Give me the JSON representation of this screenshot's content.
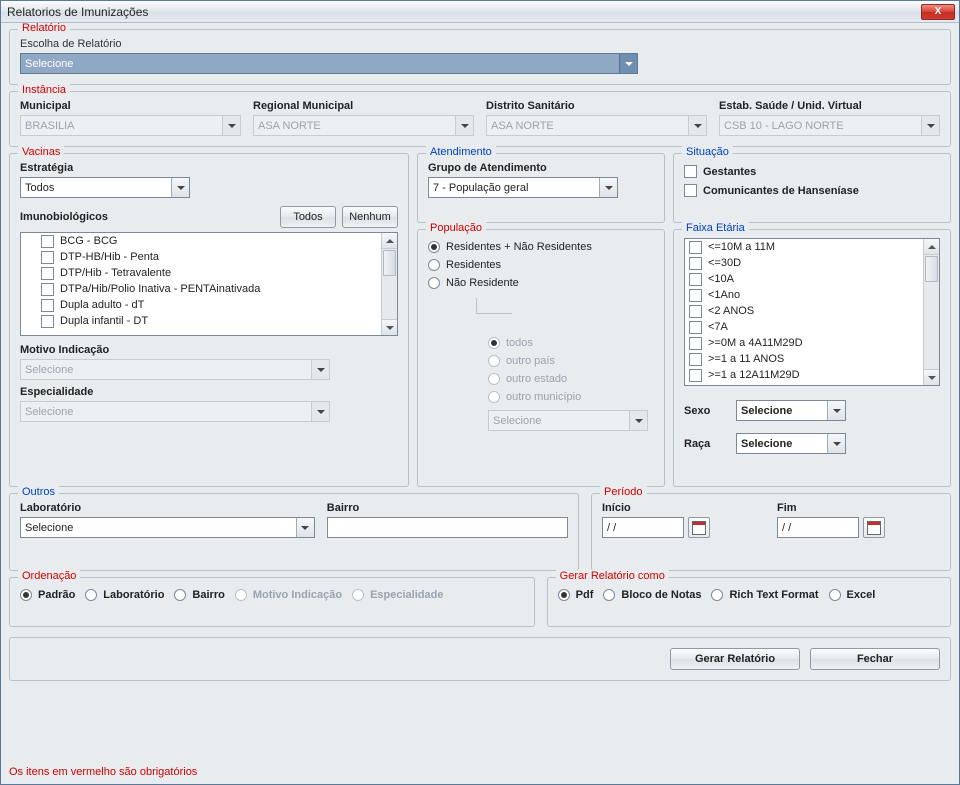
{
  "window": {
    "title": "Relatorios de Imunizações"
  },
  "relatorio": {
    "legend": "Relatório",
    "escolha_label": "Escolha de Relatório",
    "selecione": "Selecione"
  },
  "instancia": {
    "legend": "Instância",
    "municipal_label": "Municipal",
    "municipal_value": "BRASILIA",
    "regional_label": "Regional Municipal",
    "regional_value": "ASA NORTE",
    "distrito_label": "Distrito Sanitário",
    "distrito_value": "ASA NORTE",
    "estab_label": "Estab. Saúde / Unid. Virtual",
    "estab_value": "CSB 10 - LAGO NORTE"
  },
  "vacinas": {
    "legend": "Vacinas",
    "estrategia_label": "Estratégia",
    "estrategia_value": "Todos",
    "imuno_label": "Imunobiológicos",
    "btn_todos": "Todos",
    "btn_nenhum": "Nenhum",
    "items": [
      "BCG - BCG",
      "DTP-HB/Hib - Penta",
      "DTP/Hib - Tetravalente",
      "DTPa/Hib/Polio Inativa - PENTAinativada",
      "Dupla adulto - dT",
      "Dupla infantil - DT"
    ],
    "motivo_label": "Motivo Indicação",
    "motivo_value": "Selecione",
    "especialidade_label": "Especialidade",
    "especialidade_value": "Selecione"
  },
  "atendimento": {
    "legend": "Atendimento",
    "grupo_label": "Grupo de Atendimento",
    "grupo_value": "7 - População geral"
  },
  "situacao": {
    "legend": "Situação",
    "gestantes": "Gestantes",
    "comunicantes": "Comunicantes de Hanseníase"
  },
  "populacao": {
    "legend": "População",
    "opt1": "Residentes + Não Residentes",
    "opt2": "Residentes",
    "opt3": "Não Residente",
    "sub_todos": "todos",
    "sub_pais": "outro país",
    "sub_estado": "outro estado",
    "sub_municipio": "outro município",
    "sub_select": "Selecione"
  },
  "faixa": {
    "legend": "Faixa Etária",
    "items": [
      "<=10M a 11M",
      "<=30D",
      "<10A",
      "<1Ano",
      "<2 ANOS",
      "<7A",
      ">=0M a 4A11M29D",
      ">=1 a 11 ANOS",
      ">=1 a 12A11M29D"
    ],
    "sexo_label": "Sexo",
    "sexo_value": "Selecione",
    "raca_label": "Raça",
    "raca_value": "Selecione"
  },
  "outros": {
    "legend": "Outros",
    "laboratorio_label": "Laboratório",
    "laboratorio_value": "Selecione",
    "bairro_label": "Bairro",
    "bairro_value": ""
  },
  "periodo": {
    "legend": "Período",
    "inicio_label": "Início",
    "inicio_value": "/ /",
    "fim_label": "Fim",
    "fim_value": "/ /"
  },
  "ordenacao": {
    "legend": "Ordenação",
    "padrao": "Padrão",
    "laboratorio": "Laboratório",
    "bairro": "Bairro",
    "motivo": "Motivo Indicação",
    "especialidade": "Especialidade"
  },
  "gerar_como": {
    "legend": "Gerar Relatório como",
    "pdf": "Pdf",
    "bloco": "Bloco de Notas",
    "rtf": "Rich Text Format",
    "excel": "Excel"
  },
  "actions": {
    "gerar": "Gerar Relatório",
    "fechar": "Fechar"
  },
  "footer": "Os itens em vermelho são obrigatórios"
}
